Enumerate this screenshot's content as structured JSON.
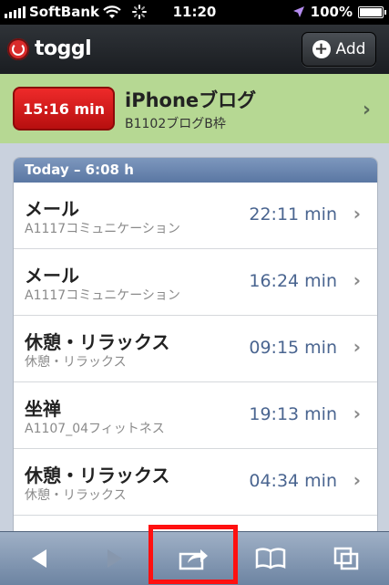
{
  "status_bar": {
    "carrier": "SoftBank",
    "time": "11:20",
    "battery": "100%"
  },
  "header": {
    "app_name": "toggl",
    "add_label": "Add"
  },
  "running_entry": {
    "timer": "15:16 min",
    "title": "iPhoneブログ",
    "project": "B1102ブログB枠"
  },
  "list": {
    "header": "Today – 6:08 h",
    "rows": [
      {
        "title": "メール",
        "project": "A1117コミュニケーション",
        "duration": "22:11 min"
      },
      {
        "title": "メール",
        "project": "A1117コミュニケーション",
        "duration": "16:24 min"
      },
      {
        "title": "休憩・リラックス",
        "project": "休憩・リラックス",
        "duration": "09:15 min"
      },
      {
        "title": "坐禅",
        "project": "A1107_04フィットネス",
        "duration": "19:13 min"
      },
      {
        "title": "休憩・リラックス",
        "project": "休憩・リラックス",
        "duration": "04:34 min"
      }
    ]
  },
  "toolbar": {
    "icons": [
      "back-icon",
      "forward-icon",
      "share-icon",
      "bookmarks-icon",
      "tabs-icon"
    ]
  },
  "colors": {
    "running_bg": "#b6d893",
    "timer_red": "#d91a1a",
    "list_header": "#6a86b0",
    "duration_text": "#4a6590",
    "highlight": "#ff1010"
  }
}
